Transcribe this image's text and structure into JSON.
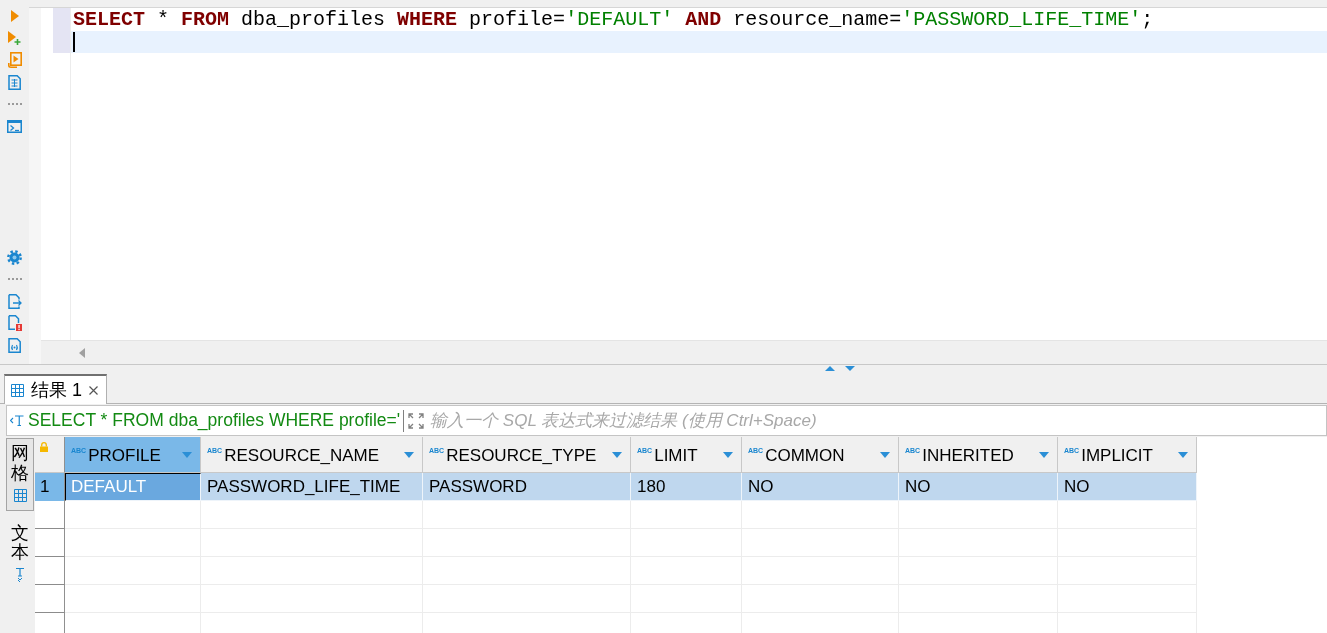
{
  "editor": {
    "lines": [
      {
        "current": false,
        "tokens": [
          {
            "kind": "keyword",
            "text": "SELECT"
          },
          {
            "kind": "plain",
            "text": " * "
          },
          {
            "kind": "keyword",
            "text": "FROM"
          },
          {
            "kind": "plain",
            "text": " dba_profiles "
          },
          {
            "kind": "keyword",
            "text": "WHERE"
          },
          {
            "kind": "plain",
            "text": " profile="
          },
          {
            "kind": "string",
            "text": "'DEFAULT' "
          },
          {
            "kind": "keyword",
            "text": "AND"
          },
          {
            "kind": "plain",
            "text": " resource_name="
          },
          {
            "kind": "string",
            "text": "'PASSWORD_LIFE_TIME'"
          },
          {
            "kind": "plain",
            "text": ";"
          }
        ]
      },
      {
        "current": true
      }
    ]
  },
  "results": {
    "tabs": [
      {
        "label": "结果 1",
        "selected": true
      }
    ],
    "filter": {
      "query": "SELECT * FROM dba_profiles WHERE profile='",
      "placeholder": "输入一个 SQL 表达式来过滤结果 (使用 Ctrl+Space)"
    },
    "view_tabs": [
      {
        "label": "网格",
        "kind": "grid",
        "selected": true
      },
      {
        "label": "文本",
        "kind": "text",
        "selected": false
      }
    ],
    "table": {
      "columns": [
        {
          "label": "PROFILE",
          "type": "ABC",
          "selected": true
        },
        {
          "label": "RESOURCE_NAME",
          "type": "ABC",
          "selected": false
        },
        {
          "label": "RESOURCE_TYPE",
          "type": "ABC",
          "selected": false
        },
        {
          "label": "LIMIT",
          "type": "ABC",
          "selected": false
        },
        {
          "label": "COMMON",
          "type": "ABC",
          "selected": false
        },
        {
          "label": "INHERITED",
          "type": "ABC",
          "selected": false
        },
        {
          "label": "IMPLICIT",
          "type": "ABC",
          "selected": false
        }
      ],
      "rows": [
        {
          "number": "1",
          "selected": true,
          "cells": [
            {
              "text": "DEFAULT",
              "focused": true
            },
            {
              "text": "PASSWORD_LIFE_TIME",
              "focused": false
            },
            {
              "text": "PASSWORD",
              "focused": false
            },
            {
              "text": "180",
              "focused": false
            },
            {
              "text": "NO",
              "focused": false
            },
            {
              "text": "NO",
              "focused": false
            },
            {
              "text": "NO",
              "focused": false
            }
          ]
        }
      ]
    }
  }
}
